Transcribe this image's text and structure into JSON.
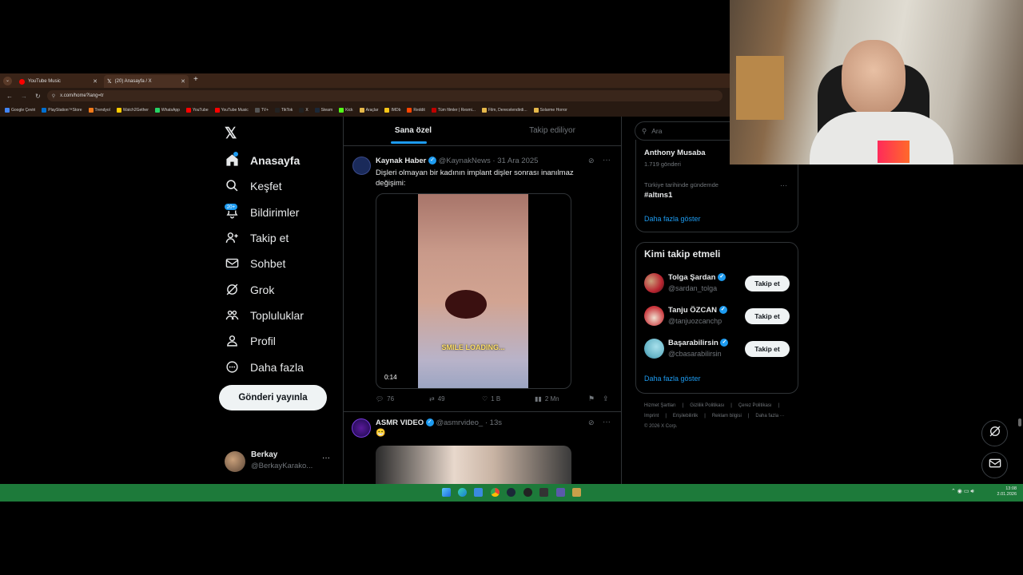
{
  "browser": {
    "tabs": [
      {
        "label": "YouTube Music"
      },
      {
        "label": "(20) Anasayfa / X"
      }
    ],
    "url": "x.com/home?lang=tr",
    "bookmarks": [
      {
        "label": "Google Çeviri",
        "color": "#4285f4"
      },
      {
        "label": "PlayStation™Store",
        "color": "#0070d1"
      },
      {
        "label": "Trendyol",
        "color": "#f27a1a"
      },
      {
        "label": "Watch2Gether",
        "color": "#ffcc00"
      },
      {
        "label": "WhatsApp",
        "color": "#25d366"
      },
      {
        "label": "YouTube",
        "color": "#ff0000"
      },
      {
        "label": "YouTube Music",
        "color": "#ff0000"
      },
      {
        "label": "TV+",
        "color": "#555555"
      },
      {
        "label": "TikTok",
        "color": "#222222"
      },
      {
        "label": "X",
        "color": "#222222"
      },
      {
        "label": "Steam",
        "color": "#1b2838"
      },
      {
        "label": "Kick",
        "color": "#53fc18"
      },
      {
        "label": "Araçlar",
        "color": "#e6b84a"
      },
      {
        "label": "IMDb",
        "color": "#f5c518"
      },
      {
        "label": "Reddit",
        "color": "#ff4500"
      },
      {
        "label": "Tüm filmler | Resmi...",
        "color": "#c00000"
      },
      {
        "label": "Film, Derecelendirdi...",
        "color": "#e6b84a"
      },
      {
        "label": "Solarme Horror",
        "color": "#e6b84a"
      }
    ]
  },
  "sidebar": {
    "items": [
      {
        "label": "Anasayfa"
      },
      {
        "label": "Keşfet"
      },
      {
        "label": "Bildirimler",
        "badge": "20+"
      },
      {
        "label": "Takip et"
      },
      {
        "label": "Sohbet"
      },
      {
        "label": "Grok"
      },
      {
        "label": "Topluluklar"
      },
      {
        "label": "Profil"
      },
      {
        "label": "Daha fazla"
      }
    ],
    "post_button": "Gönderi yayınla",
    "account": {
      "name": "Berkay",
      "handle": "@BerkayKarako...",
      "more": "···"
    }
  },
  "feed": {
    "tabs": [
      {
        "label": "Sana özel"
      },
      {
        "label": "Takip ediliyor"
      }
    ],
    "posts": [
      {
        "author": "Kaynak Haber",
        "handle": "@KaynakNews",
        "time": "· 31 Ara 2025",
        "text": "Dişleri olmayan bir kadının implant dişler sonrası inanılmaz değişimi:",
        "media_caption": "SMILE LOADING...",
        "duration": "0:14",
        "replies": "76",
        "reposts": "49",
        "likes": "1 B",
        "views": "2 Mn",
        "more": "···"
      },
      {
        "author": "ASMR VIDEO",
        "handle": "@asmrvideo_",
        "time": "· 13s",
        "text": "😁",
        "more": "···"
      }
    ]
  },
  "right": {
    "search_placeholder": "Ara",
    "trends": {
      "top_name": "Anthony Musaba",
      "top_count": "1.719 gönderi",
      "context": "Türkiye tarihinde gündemde",
      "name": "#altıns1",
      "more": "···",
      "show_more": "Daha fazla göster"
    },
    "who_to_follow": {
      "title": "Kimi takip etmeli",
      "users": [
        {
          "name": "Tolga Şardan",
          "handle": "@sardan_tolga",
          "button": "Takip et",
          "color": "#b8232f"
        },
        {
          "name": "Tanju ÖZCAN",
          "handle": "@tanjuozcanchp",
          "button": "Takip et",
          "color": "#c9343a"
        },
        {
          "name": "Başarabilirsin",
          "handle": "@cbasarabilirsin",
          "button": "Takip et",
          "color": "#6ab7c9"
        }
      ],
      "show_more": "Daha fazla göster"
    },
    "footer": {
      "links": [
        "Hizmet Şartları",
        "|",
        "Gizlilik Politikası",
        "|",
        "Çerez Politikası",
        "|",
        "Imprint",
        "|",
        "Erişilebilirlik",
        "|",
        "Reklam bilgisi",
        "|",
        "Daha fazla ···",
        "© 2026 X Corp."
      ]
    }
  },
  "taskbar": {
    "time": "13:08",
    "date": "2.01.2026"
  }
}
